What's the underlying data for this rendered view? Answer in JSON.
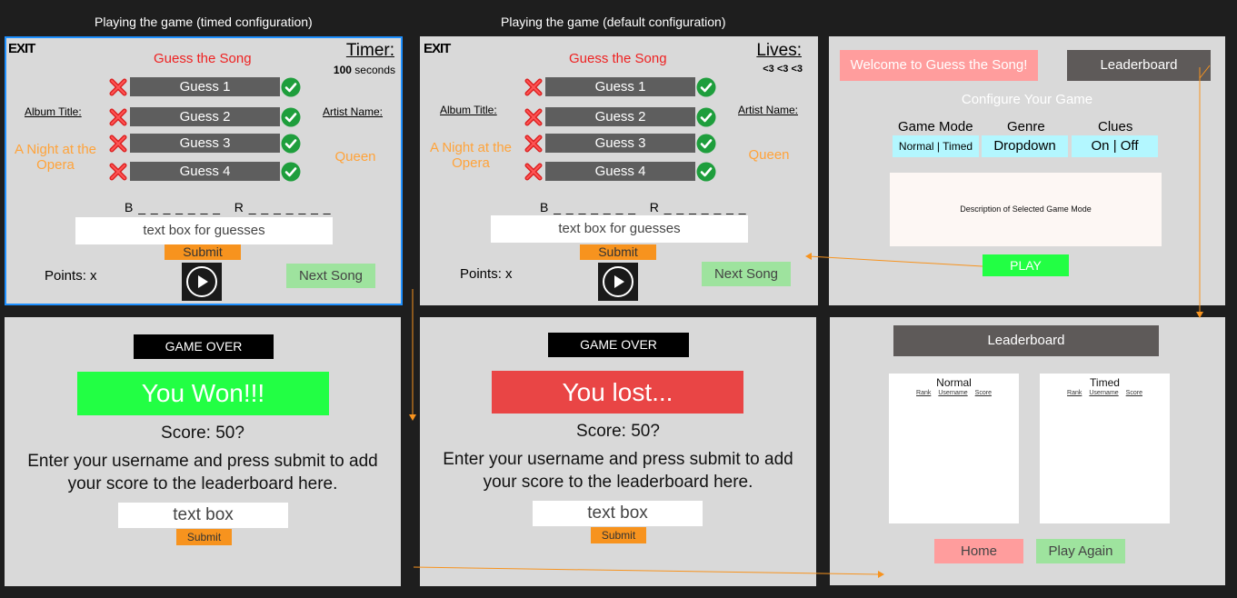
{
  "captions": {
    "timed": "Playing the game (timed configuration)",
    "default": "Playing the game (default configuration)"
  },
  "timed_game": {
    "exit": "EXIT",
    "title": "Guess the Song",
    "meter_label": "Timer:",
    "meter_num": "100",
    "meter_unit": "seconds",
    "album_label": "Album Title:",
    "album_value": "A Night at the Opera",
    "artist_label": "Artist Name:",
    "artist_value": "Queen",
    "guesses": [
      "Guess 1",
      "Guess 2",
      "Guess 3",
      "Guess 4"
    ],
    "blanks": "B _ _ _ _ _ _ _   R _ _ _ _ _ _ _",
    "input_text": "text box for guesses",
    "submit": "Submit",
    "points": "Points: x",
    "next": "Next Song"
  },
  "default_game": {
    "exit": "EXIT",
    "title": "Guess the Song",
    "meter_label": "Lives:",
    "meter_value": "<3 <3 <3",
    "album_label": "Album Title:",
    "album_value": "A Night at the Opera",
    "artist_label": "Artist Name:",
    "artist_value": "Queen",
    "guesses": [
      "Guess 1",
      "Guess 2",
      "Guess 3",
      "Guess 4"
    ],
    "blanks": "B _ _ _ _ _ _ _   R _ _ _ _ _ _ _",
    "input_text": "text box for guesses",
    "submit": "Submit",
    "points": "Points: x",
    "next": "Next Song"
  },
  "home": {
    "welcome": "Welcome to Guess the Song!",
    "leaderboard_button": "Leaderboard",
    "configure": "Configure Your Game",
    "game_mode_label": "Game Mode",
    "game_mode_normal": "Normal",
    "game_mode_timed": "Timed",
    "genre_label": "Genre",
    "genre_value": "Dropdown",
    "clues_label": "Clues",
    "clues_on": "On",
    "clues_off": "Off",
    "description": "Description of Selected Game Mode",
    "play": "PLAY"
  },
  "won": {
    "banner": "GAME OVER",
    "result": "You Won!!!",
    "score": "Score: 50?",
    "message": "Enter your username and press submit to add your score to the leaderboard here.",
    "input_text": "text box",
    "submit": "Submit"
  },
  "lost": {
    "banner": "GAME OVER",
    "result": "You lost...",
    "score": "Score: 50?",
    "message": "Enter your username and press submit to add your score to the leaderboard here.",
    "input_text": "text box",
    "submit": "Submit"
  },
  "leaderboard": {
    "title": "Leaderboard",
    "normal_title": "Normal",
    "timed_title": "Timed",
    "columns": [
      "Rank",
      "Username",
      "Score"
    ],
    "home": "Home",
    "play_again": "Play Again"
  },
  "colors": {
    "background": "#1e1e1e",
    "frame": "#d9d9d9",
    "accent_orange": "#f7931e",
    "won_green": "#22ff44",
    "lost_red": "#e94545",
    "pink": "#ff9d9d",
    "light_green": "#9ee39e",
    "cyan": "#b3f7ff",
    "selection_blue": "#1e90ff"
  }
}
